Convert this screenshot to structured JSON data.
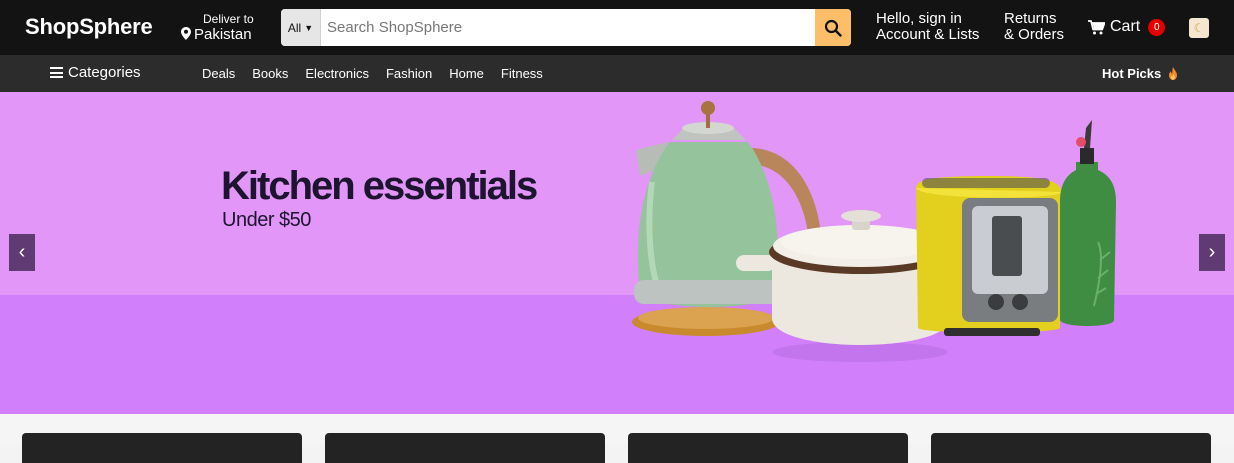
{
  "header": {
    "logo": "ShopSphere",
    "deliver_label": "Deliver to",
    "deliver_location": "Pakistan",
    "search_category": "All",
    "search_placeholder": "Search ShopSphere",
    "account_line1": "Hello, sign in",
    "account_line2": "Account & Lists",
    "returns_line1": "Returns",
    "returns_line2": "& Orders",
    "cart_label": "Cart",
    "cart_count": "0",
    "theme_toggle_icon": "moon-icon",
    "accent_color": "#febd69",
    "badge_color": "#e40000"
  },
  "nav": {
    "categories_label": "Categories",
    "links": [
      "Deals",
      "Books",
      "Electronics",
      "Fashion",
      "Home",
      "Fitness"
    ],
    "hot_picks_label": "Hot Picks",
    "hot_picks_icon": "fire-icon"
  },
  "hero": {
    "title": "Kitchen essentials",
    "subtitle": "Under $50",
    "background_color": "#e196f8",
    "image_icons": [
      "kettle-image",
      "dutch-oven-image",
      "toaster-image",
      "oil-bottle-image"
    ],
    "prev_icon": "chevron-left-icon",
    "next_icon": "chevron-right-icon"
  }
}
